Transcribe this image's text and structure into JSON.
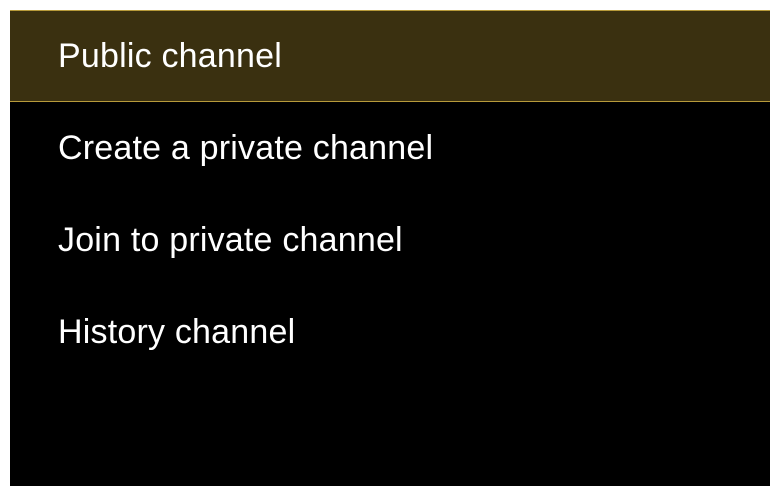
{
  "menu": {
    "selected_index": 0,
    "items": [
      {
        "label": "Public channel"
      },
      {
        "label": "Create a private channel"
      },
      {
        "label": "Join to private channel"
      },
      {
        "label": "History channel"
      }
    ]
  },
  "colors": {
    "background": "#000000",
    "selected_background": "#3a3010",
    "selected_border": "#b79a3a",
    "text": "#ffffff"
  }
}
